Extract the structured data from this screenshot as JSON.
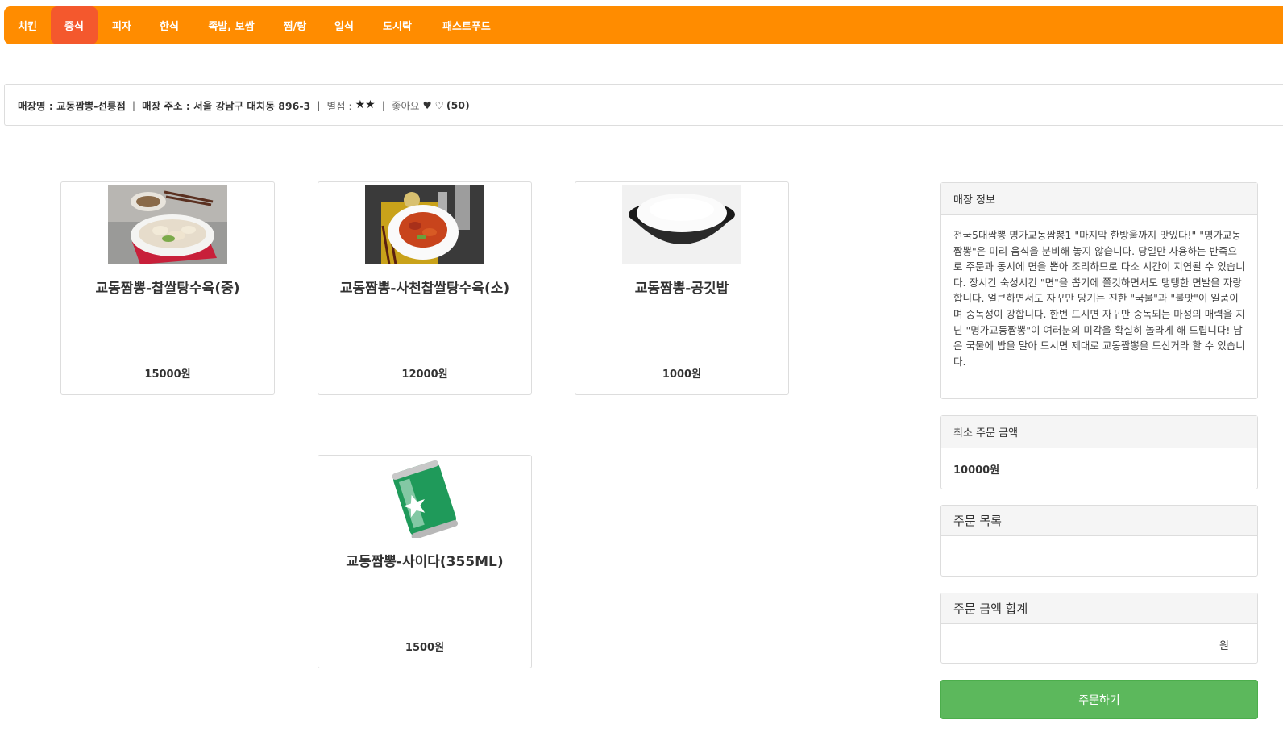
{
  "nav": {
    "items": [
      "치킨",
      "중식",
      "피자",
      "한식",
      "족발, 보쌈",
      "찜/탕",
      "일식",
      "도시락",
      "패스트푸드"
    ],
    "active_index": 1,
    "color": "#ff8c00",
    "active_color": "#f4582d"
  },
  "store": {
    "name_label": "매장명 : 교동짬뽕-선릉점",
    "address_label": "매장 주소 : 서울 강남구 대치동 896-3",
    "rating_label": "별점 :",
    "rating_stars": "★★",
    "like_label": "좋아요",
    "like_icons": "♥ ♡",
    "like_count": "(50)",
    "separator": "|"
  },
  "menu": [
    {
      "name": "교동짬뽕-찹쌀탕수육(중)",
      "price": "15000원",
      "image": "tangsuyuk-plate"
    },
    {
      "name": "교동짬뽕-사천찹쌀탕수육(소)",
      "price": "12000원",
      "image": "sichuan-tangsuyuk-plate"
    },
    {
      "name": "교동짬뽕-공깃밥",
      "price": "1000원",
      "image": "rice-bowl"
    },
    {
      "name": "교동짬뽕-사이다(355ML)",
      "price": "1500원",
      "image": "cider-can"
    }
  ],
  "sidebar": {
    "info_title": "매장 정보",
    "info_text": "전국5대짬뽕 명가교동짬뽕1 \"마지막 한방울까지 맛있다!\" \"명가교동짬뽕\"은 미리 음식을 분비해 놓지 않습니다. 당일만 사용하는 반죽으로 주문과 동시에 면을 뽑아 조리하므로 다소 시간이 지연될 수 있습니다. 장시간 숙성시킨 \"면\"을 뽑기에 쫄깃하면서도 탱탱한 면발을 자랑합니다. 얼큰하면서도 자꾸만 당기는 진한 \"국물\"과 \"불맛\"이 일품이며 중독성이 강합니다. 한번 드시면 자꾸만 중독되는 마성의 매력을 지닌 \"명가교동짬뽕\"이 여러분의 미각을 확실히 놀라게 해 드립니다! 남은 국물에 밥을 말아 드시면 제대로 교동짬뽕을 드신거라 할 수 있습니다.",
    "min_title": "최소 주문 금액",
    "min_value": "10000원",
    "list_title": "주문 목록",
    "total_title": "주문 금액 합계",
    "total_unit": "원",
    "order_button": "주문하기"
  }
}
